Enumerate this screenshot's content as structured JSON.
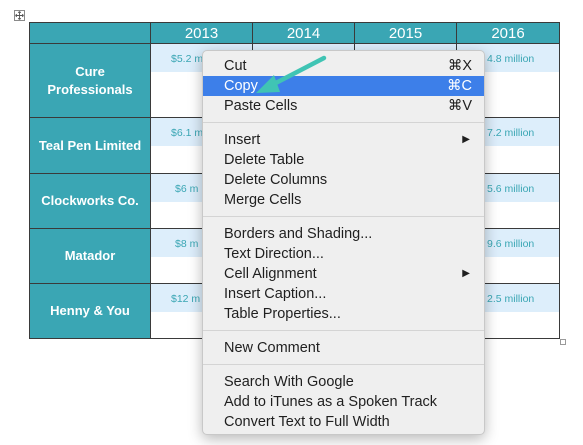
{
  "table": {
    "years": [
      "2013",
      "2014",
      "2015",
      "2016"
    ],
    "rows": [
      {
        "company": "Cure Professionals",
        "v2013": "$5.2 m",
        "v2016": "4.8 million"
      },
      {
        "company": "Teal Pen Limited",
        "v2013": "$6.1 m",
        "v2016": "7.2 million"
      },
      {
        "company": "Clockworks Co.",
        "v2013": "$6 m",
        "v2016": "5.6 million"
      },
      {
        "company": "Matador",
        "v2013": "$8 m",
        "v2016": "9.6 million"
      },
      {
        "company": "Henny & You",
        "v2013": "$12 m",
        "v2016": "2.5 million"
      }
    ]
  },
  "context_menu": {
    "cut": {
      "label": "Cut",
      "shortcut": "⌘X"
    },
    "copy": {
      "label": "Copy",
      "shortcut": "⌘C"
    },
    "paste_cells": {
      "label": "Paste Cells",
      "shortcut": "⌘V"
    },
    "insert": {
      "label": "Insert"
    },
    "delete_table": {
      "label": "Delete Table"
    },
    "delete_columns": {
      "label": "Delete Columns"
    },
    "merge_cells": {
      "label": "Merge Cells"
    },
    "borders_shading": {
      "label": "Borders and Shading..."
    },
    "text_direction": {
      "label": "Text Direction..."
    },
    "cell_alignment": {
      "label": "Cell Alignment"
    },
    "insert_caption": {
      "label": "Insert Caption..."
    },
    "table_properties": {
      "label": "Table Properties..."
    },
    "new_comment": {
      "label": "New Comment"
    },
    "search_google": {
      "label": "Search With Google"
    },
    "add_itunes": {
      "label": "Add to iTunes as a Spoken Track"
    },
    "convert_full_width": {
      "label": "Convert Text to Full Width"
    }
  },
  "colors": {
    "accent_teal": "#3aa6b4",
    "cell_band": "#ddeefb",
    "menu_highlight": "#3d7fe9",
    "annotation_arrow": "#40c4b4"
  }
}
